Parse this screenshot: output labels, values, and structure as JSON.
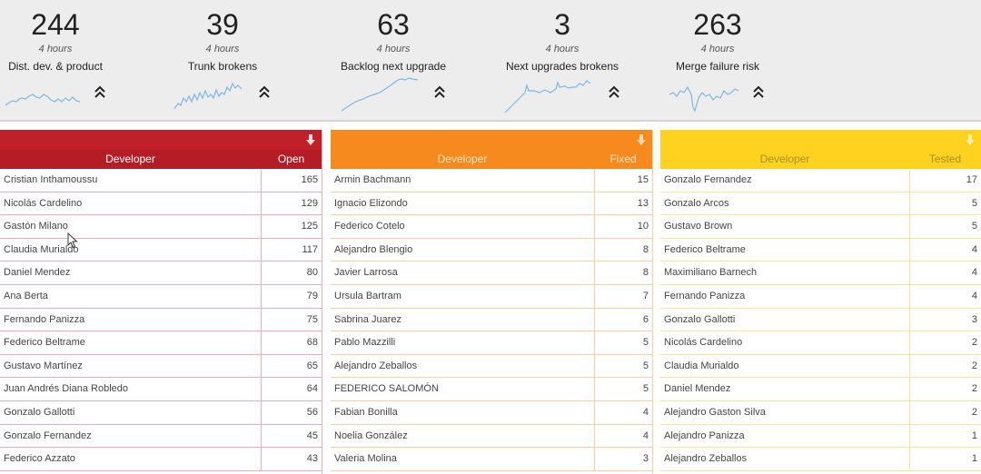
{
  "metrics": [
    {
      "value": "244",
      "period": "4 hours",
      "label": "Dist. dev. & product",
      "trend_icon": "double-chevron-up-icon"
    },
    {
      "value": "39",
      "period": "4 hours",
      "label": "Trunk brokens",
      "trend_icon": "double-chevron-up-icon"
    },
    {
      "value": "63",
      "period": "4 hours",
      "label": "Backlog next upgrade",
      "trend_icon": "double-chevron-up-icon"
    },
    {
      "value": "3",
      "period": "4 hours",
      "label": "Next upgrades brokens",
      "trend_icon": "double-chevron-up-icon"
    },
    {
      "value": "263",
      "period": "4 hours",
      "label": "Merge failure risk",
      "trend_icon": "double-chevron-up-icon"
    }
  ],
  "colors": {
    "red": "#c0202a",
    "orange": "#f68a1e",
    "yellow": "#ffd21f",
    "sparkline": "#7fb6e6"
  },
  "panels": {
    "red": {
      "download_icon": "download-arrow-icon",
      "columns": [
        "Developer",
        "Open"
      ],
      "rows": [
        {
          "name": "Cristian Inthamoussu",
          "value": "165"
        },
        {
          "name": "Nicolás Cardelino",
          "value": "129"
        },
        {
          "name": "Gastón Milano",
          "value": "125"
        },
        {
          "name": "Claudia Murialdo",
          "value": "117"
        },
        {
          "name": "Daniel Mendez",
          "value": "80"
        },
        {
          "name": "Ana Berta",
          "value": "79"
        },
        {
          "name": "Fernando Panizza",
          "value": "75"
        },
        {
          "name": "Federico Beltrame",
          "value": "68"
        },
        {
          "name": "Gustavo Martínez",
          "value": "65"
        },
        {
          "name": "Juan Andrés Diana Robledo",
          "value": "64"
        },
        {
          "name": "Gonzalo Gallotti",
          "value": "56"
        },
        {
          "name": "Gonzalo Fernandez",
          "value": "45"
        },
        {
          "name": "Federico Azzato",
          "value": "43"
        }
      ]
    },
    "orange": {
      "download_icon": "download-arrow-icon",
      "columns": [
        "Developer",
        "Fixed"
      ],
      "rows": [
        {
          "name": "Armin Bachmann",
          "value": "15"
        },
        {
          "name": "Ignacio Elizondo",
          "value": "13"
        },
        {
          "name": "Federico Cotelo",
          "value": "10"
        },
        {
          "name": "Alejandro Blengio",
          "value": "8"
        },
        {
          "name": "Javier Larrosa",
          "value": "8"
        },
        {
          "name": "Ursula Bartram",
          "value": "7"
        },
        {
          "name": "Sabrina Juarez",
          "value": "6"
        },
        {
          "name": "Pablo Mazzilli",
          "value": "5"
        },
        {
          "name": "Alejandro Zeballos",
          "value": "5"
        },
        {
          "name": "FEDERICO SALOMÓN",
          "value": "5"
        },
        {
          "name": "Fabian Bonilla",
          "value": "4"
        },
        {
          "name": "Noelia González",
          "value": "4"
        },
        {
          "name": "Valeria Molina",
          "value": "3"
        }
      ]
    },
    "yellow": {
      "download_icon": "download-arrow-icon",
      "columns": [
        "Developer",
        "Tested"
      ],
      "rows": [
        {
          "name": "Gonzalo Fernandez",
          "value": "17"
        },
        {
          "name": "Gonzalo Arcos",
          "value": "5"
        },
        {
          "name": "Gustavo Brown",
          "value": "5"
        },
        {
          "name": "Federico Beltrame",
          "value": "4"
        },
        {
          "name": "Maximiliano Barnech",
          "value": "4"
        },
        {
          "name": "Fernando Panizza",
          "value": "4"
        },
        {
          "name": "Gonzalo Gallotti",
          "value": "3"
        },
        {
          "name": "Nicolás Cardelino",
          "value": "2"
        },
        {
          "name": "Claudia Murialdo",
          "value": "2"
        },
        {
          "name": "Daniel Mendez",
          "value": "2"
        },
        {
          "name": "Alejandro Gaston Silva",
          "value": "2"
        },
        {
          "name": "Alejandro Panizza",
          "value": "1"
        },
        {
          "name": "Alejandro Zeballos",
          "value": "1"
        }
      ]
    }
  }
}
